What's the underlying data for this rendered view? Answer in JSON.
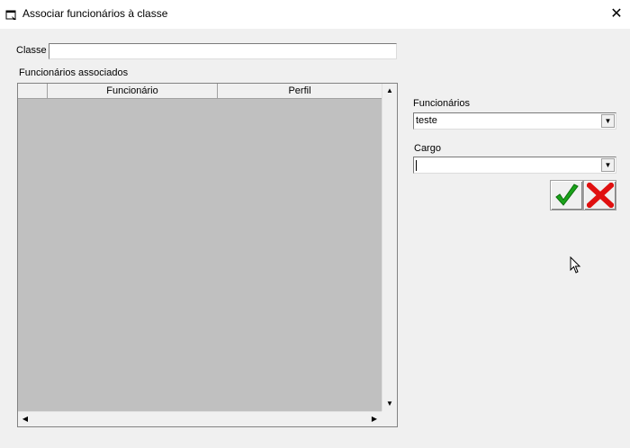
{
  "window": {
    "title": "Associar funcionários à classe",
    "close_glyph": "✕",
    "icon": "form-icon"
  },
  "classe": {
    "label": "Classe",
    "value": ""
  },
  "associados": {
    "label": "Funcionários associados",
    "columns": [
      "",
      "Funcionário",
      "Perfil"
    ],
    "rows": []
  },
  "funcionarios": {
    "label": "Funcionários",
    "selected": "teste"
  },
  "cargo": {
    "label": "Cargo",
    "selected": ""
  },
  "buttons": {
    "confirm_icon": "checkmark-icon",
    "cancel_icon": "x-icon",
    "confirm_color": "#1aa31a",
    "cancel_color": "#e01010"
  }
}
